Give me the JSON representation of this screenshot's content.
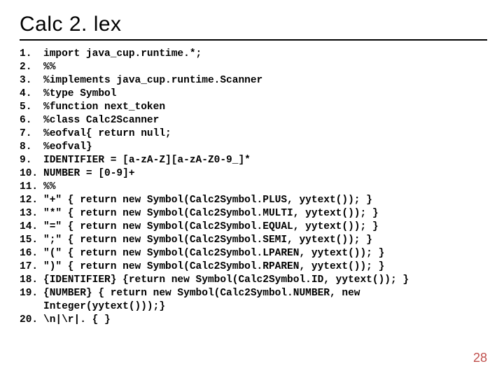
{
  "title": "Calc 2. lex",
  "page_number": "28",
  "code": {
    "lines": [
      {
        "n": "1.",
        "text": "import java_cup.runtime.*;"
      },
      {
        "n": "2.",
        "text": "%%"
      },
      {
        "n": "3.",
        "text": "%implements java_cup.runtime.Scanner"
      },
      {
        "n": "4.",
        "text": "%type Symbol"
      },
      {
        "n": "5.",
        "text": "%function next_token"
      },
      {
        "n": "6.",
        "text": "%class Calc2Scanner"
      },
      {
        "n": "7.",
        "text": "%eofval{ return null;"
      },
      {
        "n": "8.",
        "text": "%eofval}"
      },
      {
        "n": "9.",
        "text": "IDENTIFIER = [a-zA-Z][a-zA-Z0-9_]*"
      },
      {
        "n": "10.",
        "text": "NUMBER = [0-9]+"
      },
      {
        "n": "11.",
        "text": "%%"
      },
      {
        "n": "12.",
        "text": "\"+\" { return new Symbol(Calc2Symbol.PLUS, yytext()); }"
      },
      {
        "n": "13.",
        "text": "\"*\" { return new Symbol(Calc2Symbol.MULTI, yytext()); }"
      },
      {
        "n": "14.",
        "text": "\"=\" { return new Symbol(Calc2Symbol.EQUAL, yytext()); }"
      },
      {
        "n": "15.",
        "text": "\";\" { return new Symbol(Calc2Symbol.SEMI, yytext()); }"
      },
      {
        "n": "16.",
        "text": "\"(\" { return new Symbol(Calc2Symbol.LPAREN, yytext()); }"
      },
      {
        "n": "17.",
        "text": "\")\" { return new Symbol(Calc2Symbol.RPAREN, yytext()); }"
      },
      {
        "n": "18.",
        "text": "{IDENTIFIER} {return new Symbol(Calc2Symbol.ID, yytext()); }"
      },
      {
        "n": "19.",
        "text": "{NUMBER} { return new Symbol(Calc2Symbol.NUMBER, new"
      },
      {
        "n": "",
        "text": "Integer(yytext()));}"
      },
      {
        "n": "20.",
        "text": "\\n|\\r|. { }"
      }
    ]
  }
}
